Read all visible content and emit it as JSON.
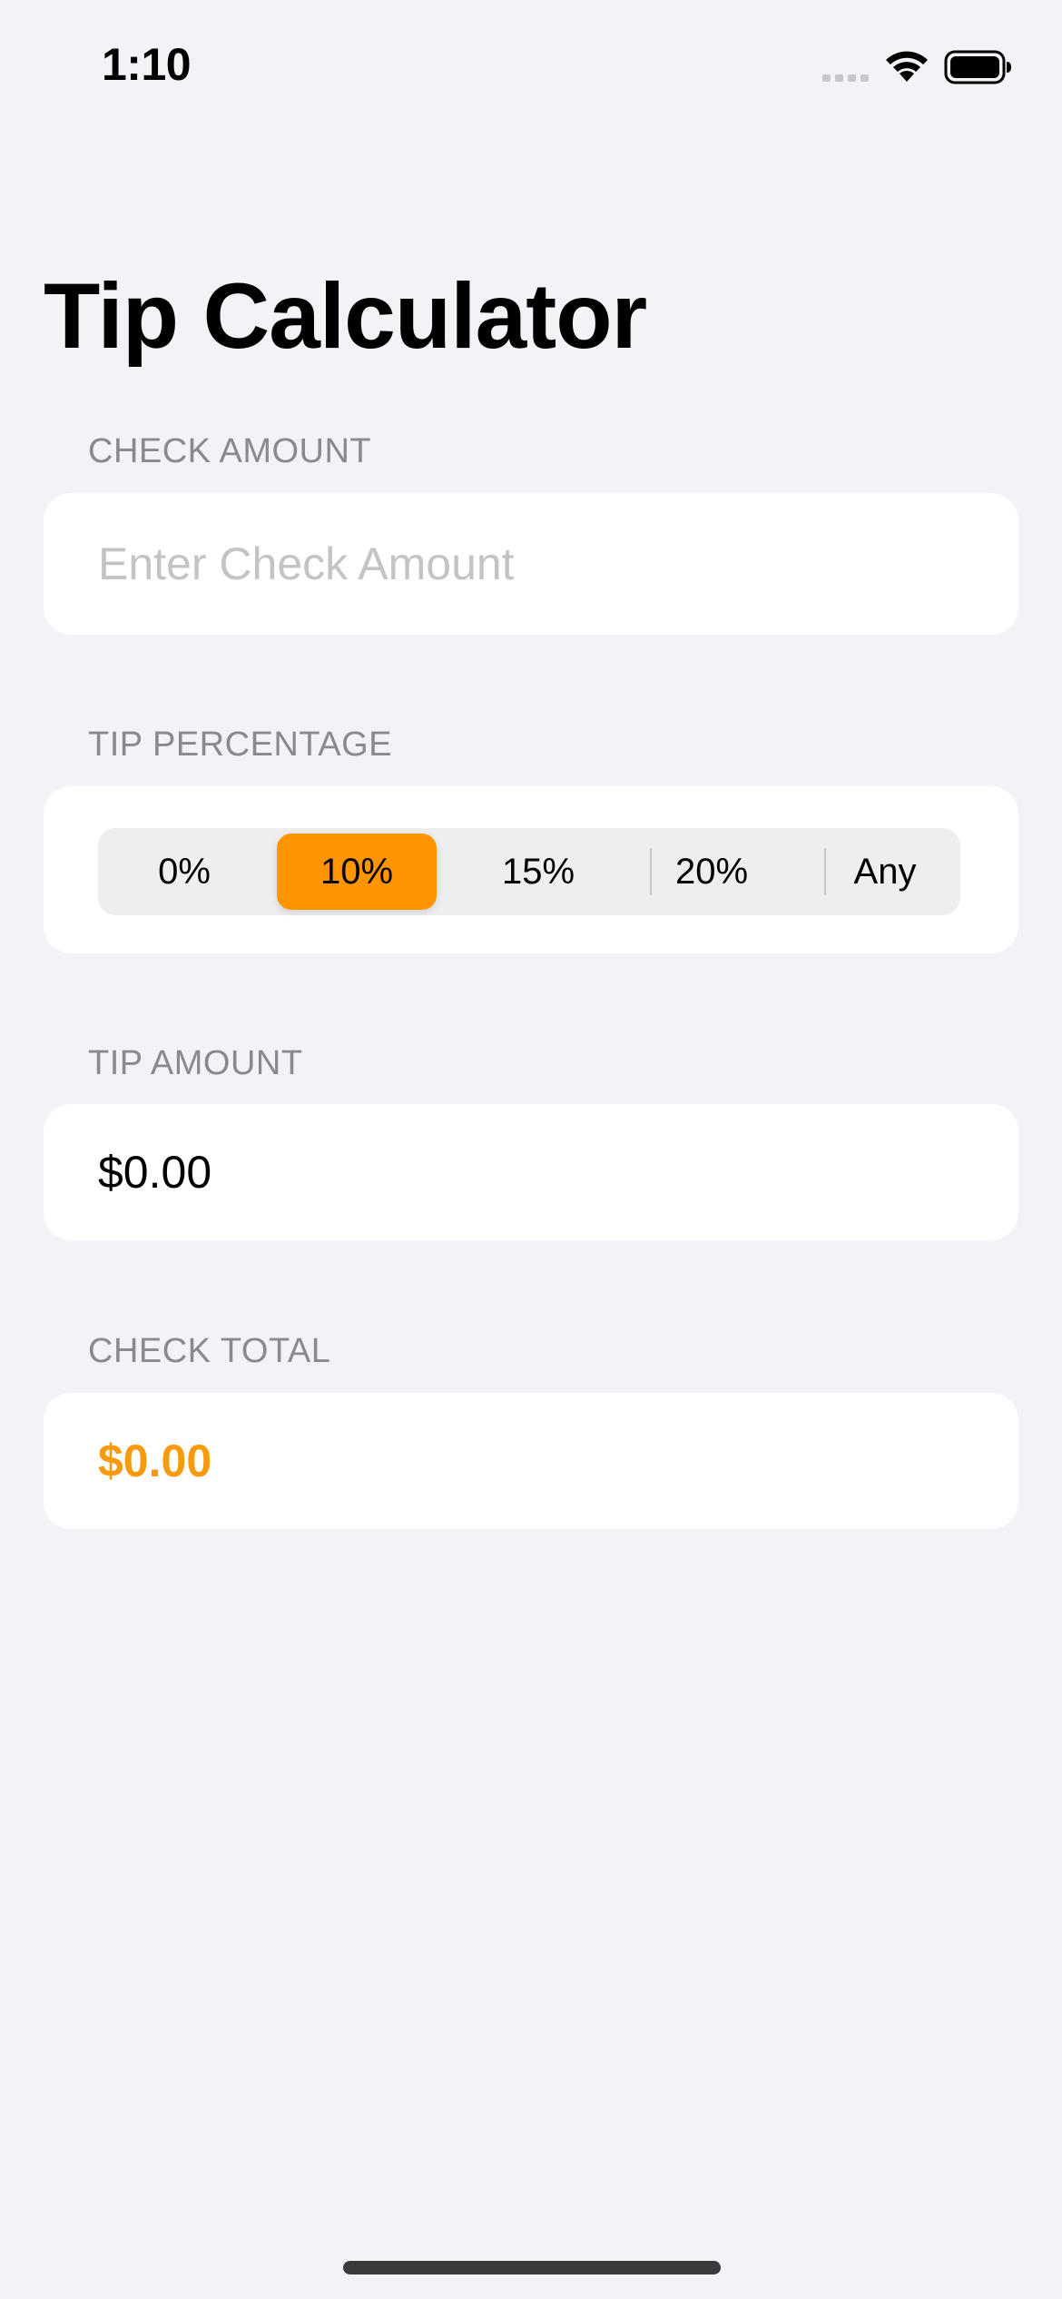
{
  "status_bar": {
    "time": "1:10",
    "signal_icon": "cellular-signal-icon",
    "wifi_icon": "wifi-icon",
    "battery_icon": "battery-full-icon"
  },
  "title": "Tip Calculator",
  "check_amount": {
    "header": "CHECK AMOUNT",
    "value": "",
    "placeholder": "Enter Check Amount"
  },
  "tip_percentage": {
    "header": "TIP PERCENTAGE",
    "options": [
      "0%",
      "10%",
      "15%",
      "20%",
      "Any"
    ],
    "selected": "10%"
  },
  "tip_amount": {
    "header": "TIP AMOUNT",
    "value": "$0.00"
  },
  "check_total": {
    "header": "CHECK TOTAL",
    "value": "$0.00"
  },
  "colors": {
    "accent": "#FF9500",
    "background": "#F2F2F7",
    "card": "#FFFFFF",
    "section_header": "#8A8A8E",
    "placeholder": "#C4C4C7"
  }
}
